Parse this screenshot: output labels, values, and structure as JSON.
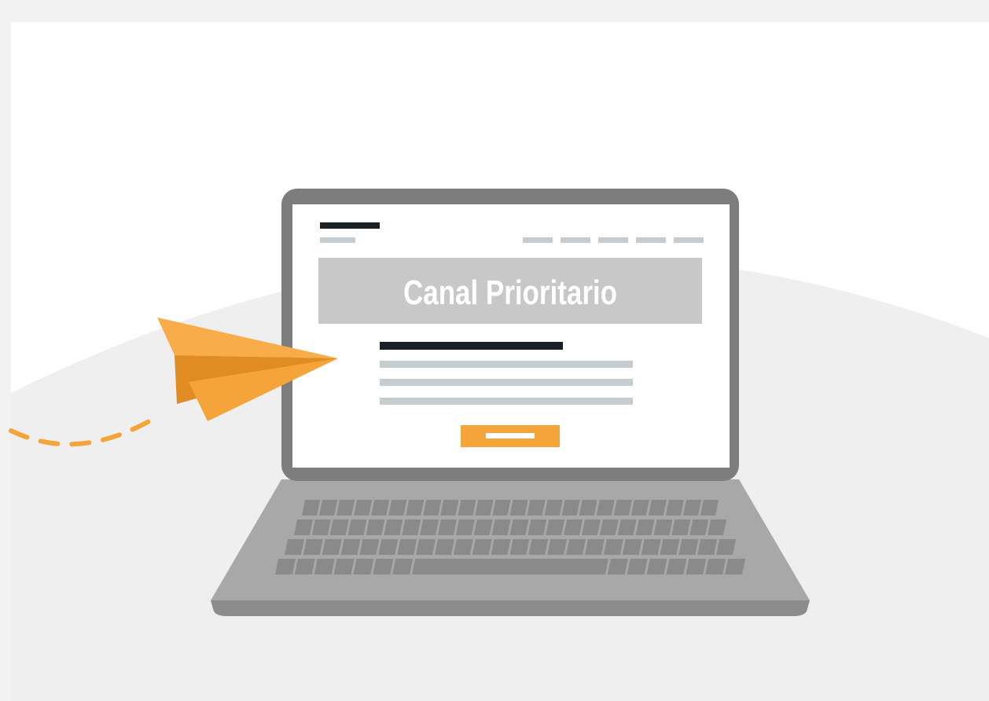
{
  "banner": {
    "title": "Canal Prioritario"
  },
  "icons": {
    "laptop": "laptop-icon",
    "paper_plane": "paper-plane-icon"
  },
  "colors": {
    "background": "#f2f2f2",
    "card": "#ffffff",
    "curve": "#efefef",
    "laptop_frame": "#7d7d7d",
    "laptop_base": "#a8a8a8",
    "keyboard_keys": "#8a8a8a",
    "banner": "#c8c8c8",
    "placeholder_lines": "#c6cdd1",
    "dark_lines": "#1b1f26",
    "accent": "#f5a43a",
    "accent_dark": "#e08c22"
  }
}
